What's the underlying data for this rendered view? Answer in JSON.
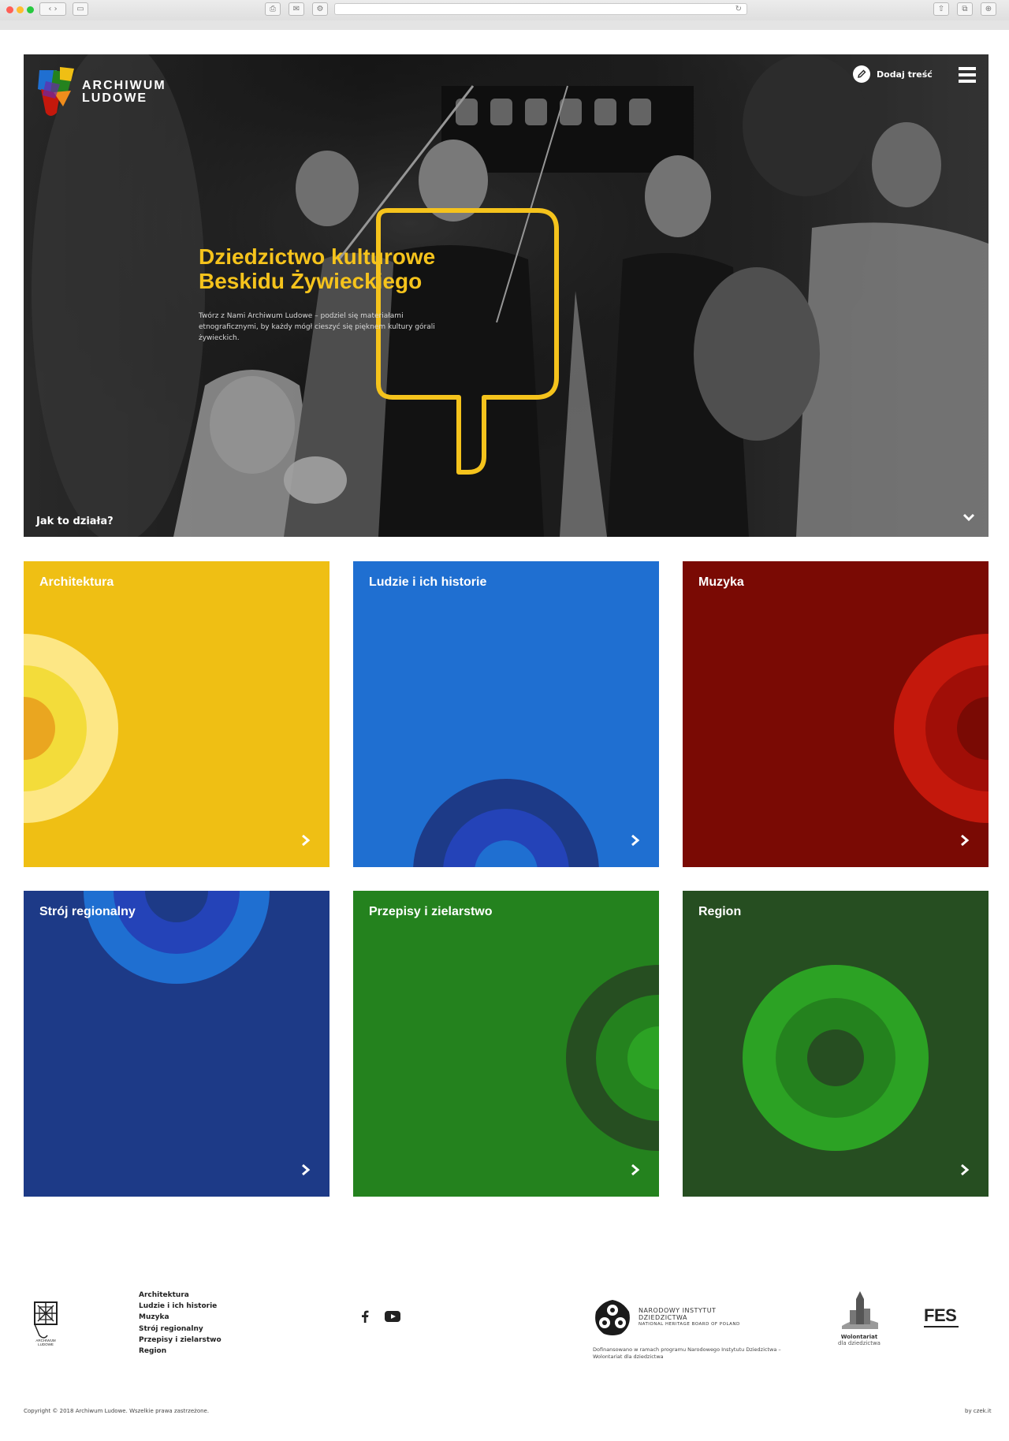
{
  "hero": {
    "logo_line1": "ARCHIWUM",
    "logo_line2": "LUDOWE",
    "add_label": "Dodaj treść",
    "title_line1": "Dziedzictwo kulturowe",
    "title_line2": "Beskidu Żywieckiego",
    "description": "Twórz z Nami Archiwum Ludowe – podziel się materiałami etnograficznymi, by każdy mógł cieszyć się pięknem kultury górali żywieckich.",
    "how_label": "Jak to działa?",
    "accent_color": "#f5c31c"
  },
  "tiles": [
    {
      "title": "Architektura",
      "color": "#efbf14"
    },
    {
      "title": "Ludzie i ich historie",
      "color": "#1f6fd1"
    },
    {
      "title": "Muzyka",
      "color": "#7a0a04"
    },
    {
      "title": "Strój regionalny",
      "color": "#1d3a87"
    },
    {
      "title": "Przepisy i zielarstwo",
      "color": "#24821e"
    },
    {
      "title": "Region",
      "color": "#264e21"
    }
  ],
  "footer": {
    "nav": [
      "Architektura",
      "Ludzie i ich historie",
      "Muzyka",
      "Strój regionalny",
      "Przepisy i zielarstwo",
      "Region"
    ],
    "logo_line1": "ARCHIWUM",
    "logo_line2": "LUDOWE",
    "nid_line1": "NARODOWY INSTYTUT",
    "nid_line2": "DZIEDZICTWA",
    "nid_line3": "NATIONAL HERITAGE BOARD OF POLAND",
    "nid_sub": "Dofinansowano w ramach programu Narodowego Instytutu Dziedzictwa – Wolontariat dla dziedzictwa",
    "wol_line1": "Wolontariat",
    "wol_line2": "dla dziedzictwa",
    "fes": "FES",
    "copyright": "Copyright © 2018 Archiwum Ludowe. Wszelkie prawa zastrzeżone.",
    "by": "by czek.it"
  }
}
